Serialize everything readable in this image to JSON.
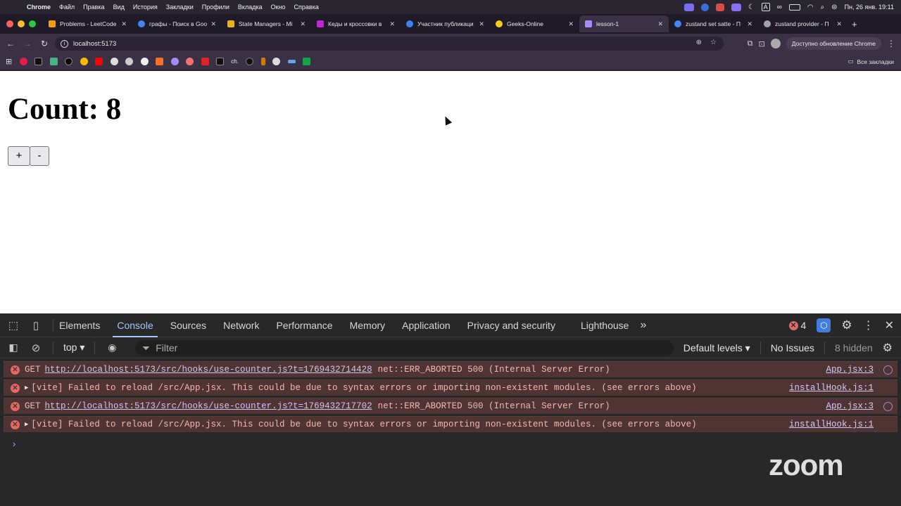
{
  "menubar": {
    "app": "Chrome",
    "items": [
      "Файл",
      "Правка",
      "Вид",
      "История",
      "Закладки",
      "Профили",
      "Вкладка",
      "Окно",
      "Справка"
    ],
    "datetime": "Пн, 26 янв.  19:11"
  },
  "tabs": [
    {
      "label": "Problems - LeetCode",
      "color": "#f59e0b"
    },
    {
      "label": "графы - Поиск в Goo",
      "color": "#4285f4"
    },
    {
      "label": "State Managers - Mi",
      "color": "#eab308"
    },
    {
      "label": "Кеды и кроссовки в",
      "color": "#c026d3"
    },
    {
      "label": "Участник публикаци",
      "color": "#3b82f6"
    },
    {
      "label": "Geeks-Online",
      "color": "#facc15"
    },
    {
      "label": "lesson-1",
      "color": "#a78bfa",
      "active": true
    },
    {
      "label": "zustand set satte - П",
      "color": "#4285f4"
    },
    {
      "label": "zustand provider - П",
      "color": "#9ca3af"
    }
  ],
  "address": {
    "url": "localhost:5173",
    "update_label": "Доступно обновление Chrome"
  },
  "bookmarks": {
    "all_label": "Все закладки",
    "text_item": "ch."
  },
  "page": {
    "heading": "Count: 8",
    "increment": "+",
    "decrement": "-"
  },
  "devtools": {
    "tabs": [
      "Elements",
      "Console",
      "Sources",
      "Network",
      "Performance",
      "Memory",
      "Application",
      "Privacy and security",
      "Lighthouse"
    ],
    "active_tab": "Console",
    "more": "»",
    "error_count": "4",
    "context": "top",
    "filter_placeholder": "Filter",
    "levels": "Default levels",
    "issues": "No Issues",
    "hidden": "8 hidden",
    "messages": [
      {
        "prefix": "GET",
        "link": "http://localhost:5173/src/hooks/use-counter.js?t=1769432714428",
        "text": "net::ERR_ABORTED 500 (Internal Server Error)",
        "source": "App.jsx:3",
        "expandable": false
      },
      {
        "prefix": "",
        "link": "",
        "text": "[vite] Failed to reload /src/App.jsx. This could be due to syntax errors or importing non-existent modules. (see errors above)",
        "source": "installHook.js:1",
        "expandable": true
      },
      {
        "prefix": "GET",
        "link": "http://localhost:5173/src/hooks/use-counter.js?t=1769432717702",
        "text": "net::ERR_ABORTED 500 (Internal Server Error)",
        "source": "App.jsx:3",
        "expandable": false
      },
      {
        "prefix": "",
        "link": "",
        "text": "[vite] Failed to reload /src/App.jsx. This could be due to syntax errors or importing non-existent modules. (see errors above)",
        "source": "installHook.js:1",
        "expandable": true
      }
    ]
  },
  "watermark": "zoom"
}
